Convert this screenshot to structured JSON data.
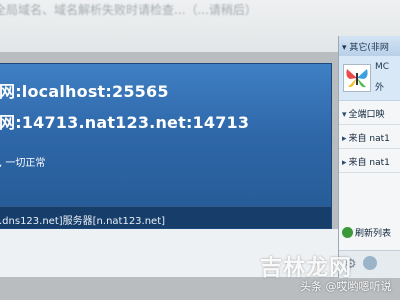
{
  "top_strip": {
    "faded_text": "全局域名、域名解析失败时请检查...（...请稍后）"
  },
  "panel": {
    "line1": "网:localhost:25565",
    "line2": "网:14713.nat123.net:14713",
    "line3": ", 一切正常",
    "footer": ".dns123.net]服务器[n.nat123.net]"
  },
  "right_pane": {
    "group_header": "其它(非网",
    "contact": {
      "name": "MC",
      "sub": "外"
    },
    "rows": [
      "全端口映",
      "来自 nat1",
      "来自 nat1"
    ],
    "refresh_label": "刷新列表"
  },
  "watermark": {
    "main": "吉林龙网",
    "credit": "头条 @哎哟嗯听说"
  },
  "colors": {
    "panel_top": "#3f7fc3",
    "panel_bottom": "#245993",
    "footer_bg": "#173d6a"
  }
}
